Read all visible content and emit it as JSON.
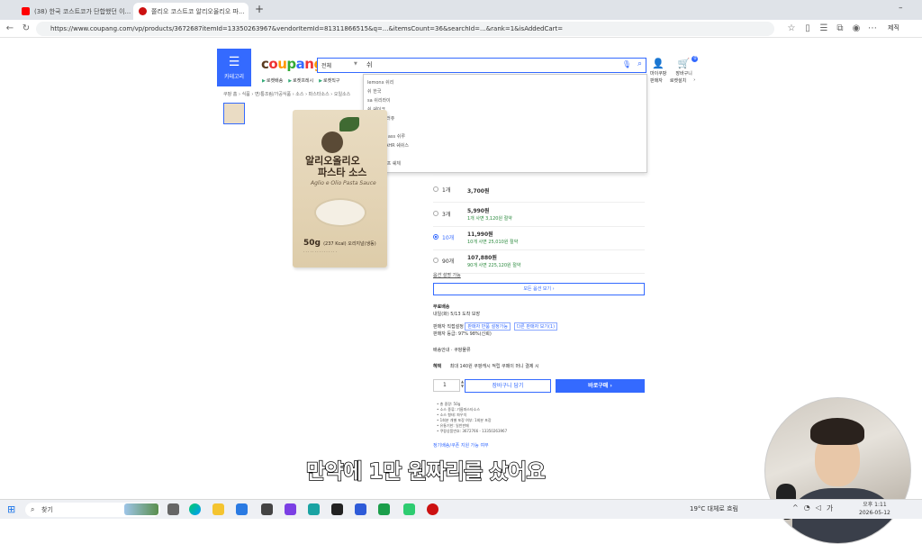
{
  "browser": {
    "tabs": [
      {
        "label": "(38) 한국 코스트코가 단합했던 이..."
      },
      {
        "label": "쫄리오 코스트코 알리오올리오 파..."
      }
    ],
    "new_tab": "+",
    "url": "https://www.coupang.com/vp/products/3672687itemId=13350263967&vendorItemId=81311866515&q=...&itemsCount=36&searchId=...&rank=1&isAddedCart=",
    "profile_label": "제직"
  },
  "header": {
    "category_label": "카테고리",
    "logo": "coupang",
    "search_scope": "전체",
    "search_value": "쉬",
    "suggestions": [
      "lemonx 쉬리",
      "쉬 한국",
      "sa 쉬리라이",
      "쉬 쉐이크",
      "쉬cx 쉬프러쥬",
      "쉬 쓰어스",
      "allas pro ass 쉬루",
      "쉬리셔 쉬AHR 쉐쉬스",
      "쉬리오",
      "쉬 쉬리 쉬프 쉐체"
    ],
    "quick_menu": [
      "로켓배송",
      "로켓프레시",
      "로켓직구"
    ],
    "right_menu": [
      {
        "icon": "user-icon",
        "label": "마이쿠팡"
      },
      {
        "icon": "cart-icon",
        "label": "장바구니",
        "badge": "0"
      }
    ],
    "right_links": [
      "판매자",
      "로켓설치"
    ]
  },
  "breadcrumb": "쿠팡 홈 › 식품 › 면/통조림/가공식품 › 소스 › 파스타소스 › 오일소스",
  "product": {
    "package_title_line1": "알리오올리오",
    "package_title_line2": "파스타 소스",
    "package_sub": "Aglio e Olio Pasta Sauce",
    "package_weight": "50g",
    "package_kcal": "(237 Kcal) 오리지널(냉동)"
  },
  "options": [
    {
      "qty": "1개",
      "price": "3,700원",
      "sub": "",
      "selected": false
    },
    {
      "qty": "3개",
      "price": "5,990원",
      "sub": "1개 사면 3,120원 절약",
      "selected": false
    },
    {
      "qty": "10개",
      "price": "11,990원",
      "sub": "10개 사면 25,010원 절약",
      "selected": true
    },
    {
      "qty": "90개",
      "price": "107,880원",
      "sub": "90개 사면 225,120원 절약",
      "selected": false
    }
  ],
  "options_all_link": "옵션 설명 가능",
  "all_button": "모든 옵션 보기 ›",
  "info": {
    "shipping_label": "무료배송",
    "shipping_date": "내일(화) 5/13 도착 보장",
    "return_label": "판매자 직접설정",
    "return_pills": [
      "판매자 반품 설정가능",
      "다른 판매자 보기(1)"
    ],
    "seller_rating": "판매자 등급: 97% 98%(신뢰)",
    "select_label": "배송안내",
    "select_value": "쿠팡물류",
    "pay_label": "혜택",
    "pay_text": "최대 140원 쿠팡캐시 적립   쿠페이 머니 결제 시"
  },
  "purchase": {
    "qty": "1",
    "cart_button": "장바구니 담기",
    "buy_button": "바로구매 ›"
  },
  "bullets": [
    "총 중량: 50g",
    "소스 종류: 기름파스타소스",
    "소스 형태: 파우치",
    "1회분 개별 포장 여부: 1회분 포장",
    "유통기한: 일반판매",
    "쿠팡상품번호: 3672766 - 13350263967"
  ],
  "subscribe_link": "정기배송/쿠폰 지원 가능 여부",
  "caption": "만약에 1만 원짜리를 샀어요",
  "taskbar": {
    "search_placeholder": "찾기",
    "weather": "19°C  대체로 흐림",
    "time": "오후 1:11",
    "date": "2026-05-12",
    "ime": "가"
  },
  "colors": {
    "accent": "#346aff",
    "logo_c": "#5a3b1f",
    "logo_o": "#e33",
    "logo_u": "#f90",
    "logo_p": "#3a3"
  }
}
